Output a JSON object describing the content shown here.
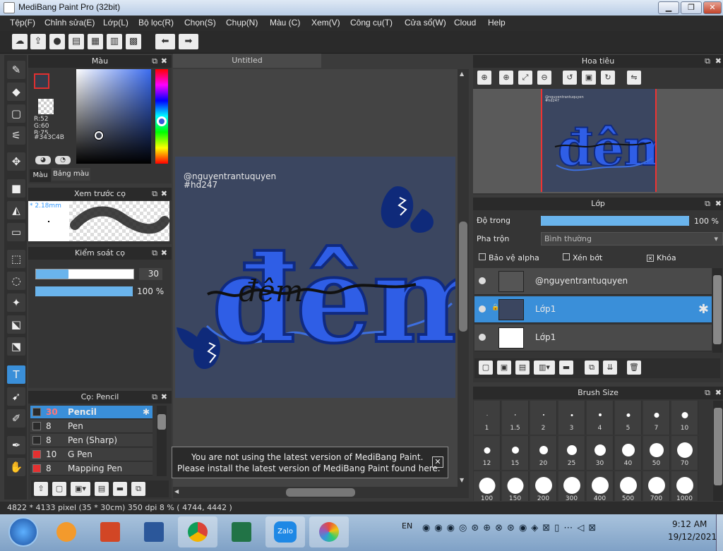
{
  "window": {
    "title": "MediBang Paint Pro (32bit)"
  },
  "menu": [
    "Tệp(F)",
    "Chỉnh sửa(E)",
    "Lớp(L)",
    "Bộ lọc(R)",
    "Chọn(S)",
    "Chụp(N)",
    "Màu (C)",
    "Xem(V)",
    "Công cụ(T)",
    "Cửa sổ(W)",
    "Cloud",
    "Help"
  ],
  "color_panel": {
    "title": "Màu",
    "r": "R:52",
    "g": "G:60",
    "b": "B:75",
    "hex": "#343C4B",
    "tab1": "Màu",
    "tab2": "Bảng màu",
    "current": "#343C4B"
  },
  "brush_preview": {
    "title": "Xem trước cọ",
    "size": "* 2.18mm"
  },
  "brush_control": {
    "title": "Kiểm soát cọ",
    "size_value": "30",
    "opacity_value": "100 %",
    "size_fraction": 0.6,
    "opacity_fraction": 1.0
  },
  "brush_list": {
    "title": "Cọ: Pencil",
    "items": [
      {
        "size": "30",
        "name": "Pencil",
        "selected": true,
        "color": "#2a2a2a"
      },
      {
        "size": "8",
        "name": "Pen",
        "selected": false,
        "color": "#2a2a2a"
      },
      {
        "size": "8",
        "name": "Pen (Sharp)",
        "selected": false,
        "color": "#2a2a2a"
      },
      {
        "size": "10",
        "name": "G Pen",
        "selected": false,
        "color": "#e53030"
      },
      {
        "size": "8",
        "name": "Mapping Pen",
        "selected": false,
        "color": "#e53030"
      }
    ]
  },
  "canvas": {
    "tab": "Untitled",
    "watermark1": "@nguyentrantuquyen",
    "watermark2": "#hd247",
    "art_text": "đêm",
    "script_text": "đêm"
  },
  "notice": {
    "line1": "You are not using the latest version of MediBang Paint.",
    "line2": "Please install the latest version of MediBang Paint found here."
  },
  "navigator": {
    "title": "Hoa tiêu",
    "mini_text1": "@nguyentrantuquyen",
    "mini_text2": "#hd247"
  },
  "layers": {
    "title": "Lớp",
    "opacity_label": "Độ trong",
    "opacity_value": "100 %",
    "opacity_fraction": 1.0,
    "blend_label": "Pha trộn",
    "blend_value": "Bình thường",
    "protect_alpha": "Bảo vệ alpha",
    "clip": "Xén bớt",
    "lock": "Khóa",
    "items": [
      {
        "name": "@nguyentrantuquyen",
        "selected": false
      },
      {
        "name": "Lớp1",
        "selected": true
      },
      {
        "name": "Lớp1",
        "selected": false
      }
    ]
  },
  "brush_size": {
    "title": "Brush Size",
    "rows": [
      [
        "1",
        "1.5",
        "2",
        "3",
        "4",
        "5",
        "7",
        "10"
      ],
      [
        "12",
        "15",
        "20",
        "25",
        "30",
        "40",
        "50",
        "70"
      ],
      [
        "100",
        "150",
        "200",
        "300",
        "400",
        "500",
        "700",
        "1000"
      ]
    ]
  },
  "status": {
    "text": "4822 * 4133 pixel  (35 * 30cm)  350 dpi  8 %  ( 4744, 4442 )"
  },
  "taskbar": {
    "lang": "EN",
    "time": "9:12 AM",
    "date": "19/12/2021",
    "zalo": "Zalo"
  },
  "colors": {
    "accent": "#3a8fd9",
    "bg": "#3b3b3b",
    "canvas": "#3b4660",
    "letter_blue": "#2f5ee6"
  }
}
